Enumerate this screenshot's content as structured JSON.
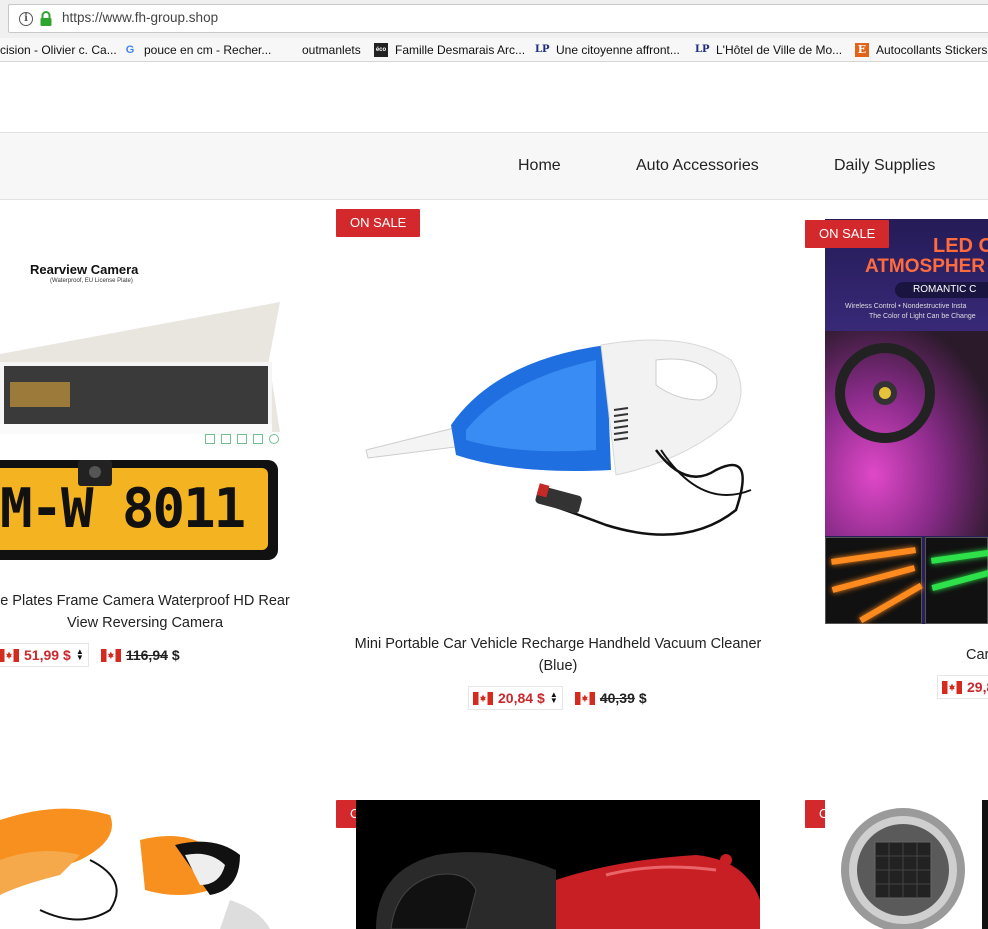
{
  "browser": {
    "url": "https://www.fh-group.shop",
    "bookmarks": [
      {
        "label": "cision - Olivier c. Ca...",
        "icon": ""
      },
      {
        "label": "pouce en cm - Recher...",
        "icon": "google-icon"
      },
      {
        "label": "outmanlets",
        "icon": ""
      },
      {
        "label": "Famille Desmarais Arc...",
        "icon": "eco-icon"
      },
      {
        "label": "Une citoyenne affront...",
        "icon": "lp-icon"
      },
      {
        "label": "L'Hôtel de Ville de Mo...",
        "icon": "lp-icon"
      },
      {
        "label": "Autocollants Stickers",
        "icon": "etsy-icon"
      }
    ]
  },
  "nav": {
    "items": [
      "Home",
      "Auto Accessories",
      "Daily Supplies"
    ]
  },
  "products": [
    {
      "title_line1": "e Plates Frame Camera Waterproof HD Rear",
      "title_line2": "View Reversing Camera",
      "sale_price": "51,99",
      "old_price": "116,94",
      "currency": "$",
      "image_caption": "Rearview Camera",
      "image_subcaption": "(Waterproof, EU License Plate)",
      "plate_text": "M-W 8011"
    },
    {
      "badge": "ON SALE",
      "title_line1": "Mini Portable Car Vehicle Recharge Handheld Vacuum Cleaner",
      "title_line2": "(Blue)",
      "sale_price": "20,84",
      "old_price": "40,39",
      "currency": "$"
    },
    {
      "badge": "ON SALE",
      "title_line1": "Car",
      "sale_price": "29,8",
      "image_heading1": "LED C",
      "image_heading2": "ATMOSPHER",
      "image_banner": "ROMANTIC C",
      "image_line1": "Wireless Control  •  Nondestructive Insta",
      "image_line2": "The Color of Light Can be Change"
    },
    {
      "title_line1": ""
    },
    {
      "badge": "ON SALE"
    },
    {
      "badge": "ON SALE"
    }
  ],
  "colors": {
    "sale_red": "#d4292c",
    "price_red": "#c9282d",
    "nav_bg": "#f7f7f7"
  }
}
